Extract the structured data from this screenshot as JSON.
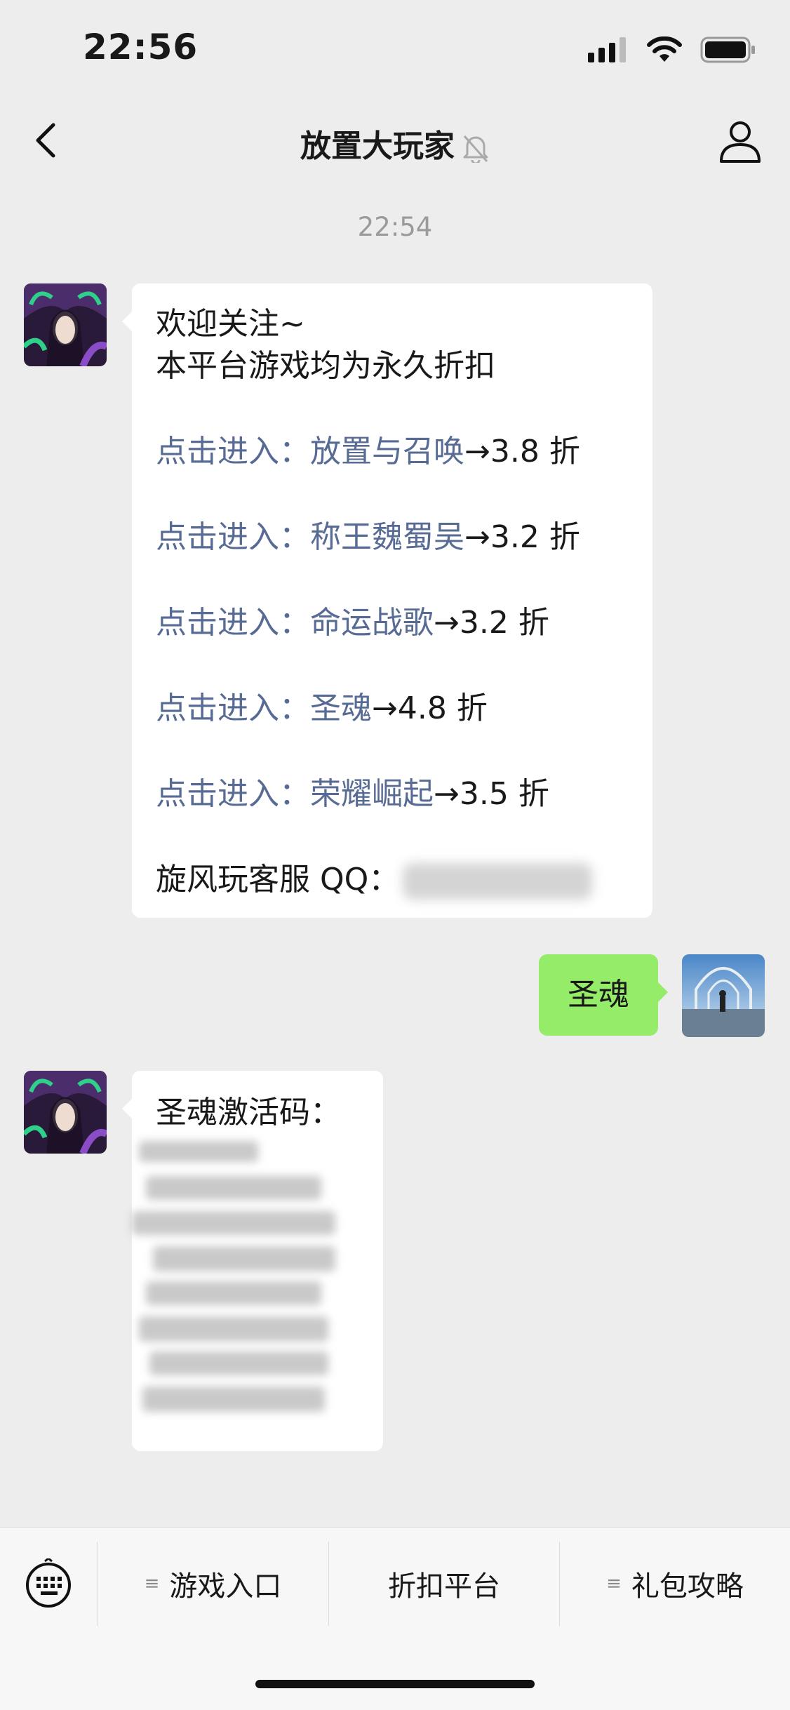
{
  "status": {
    "time": "22:56"
  },
  "nav": {
    "title": "放置大玩家",
    "back_icon": "chevron-left-icon",
    "mute_icon": "bell-off-icon",
    "profile_icon": "person-icon"
  },
  "chat": {
    "timestamp": "22:54",
    "welcome": {
      "line1": "欢迎关注~",
      "line2": "本平台游戏均为永久折扣",
      "games": [
        {
          "prefix": "点击进入：",
          "name": "放置与召唤",
          "discount": "→3.8 折"
        },
        {
          "prefix": "点击进入：",
          "name": "称王魏蜀吴",
          "discount": "→3.2 折"
        },
        {
          "prefix": "点击进入：",
          "name": "命运战歌",
          "discount": "→3.2 折"
        },
        {
          "prefix": "点击进入：",
          "name": "圣魂",
          "discount": "→4.8 折"
        },
        {
          "prefix": "点击进入：",
          "name": "荣耀崛起",
          "discount": "→3.5 折"
        }
      ],
      "service_label": "旋风玩客服 QQ："
    },
    "user_message": "圣魂",
    "reply": {
      "label": "圣魂激活码："
    }
  },
  "bottom_menu": {
    "items": [
      "游戏入口",
      "折扣平台",
      "礼包攻略"
    ],
    "glyph": "≡"
  },
  "colors": {
    "background": "#ededed",
    "link": "#576b95",
    "sent_bubble": "#95ec69"
  }
}
